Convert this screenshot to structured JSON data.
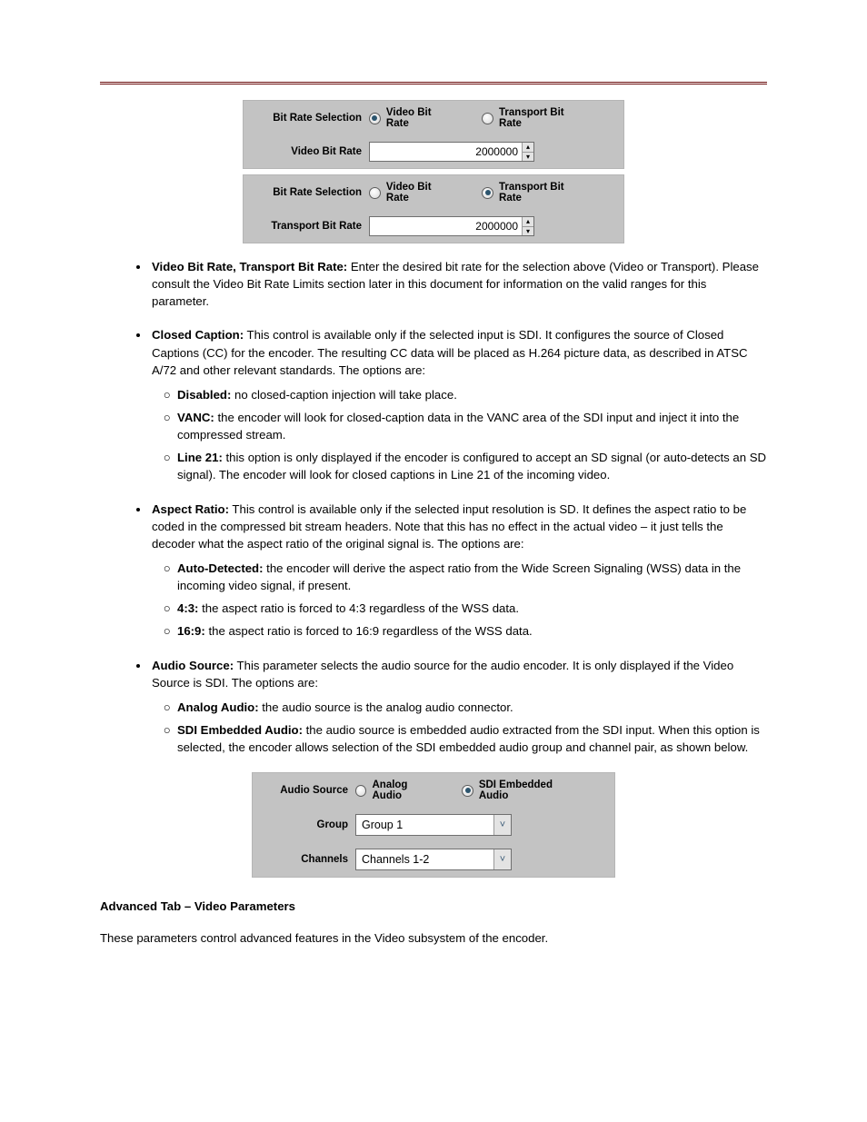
{
  "hr_color": "#6b0d0d",
  "panel1": {
    "label_sel": "Bit Rate Selection",
    "opt_video": "Video Bit Rate",
    "opt_transport": "Transport Bit Rate",
    "label_rate": "Video Bit Rate",
    "value": "2000000",
    "selected": "video"
  },
  "panel2": {
    "label_sel": "Bit Rate Selection",
    "opt_video": "Video Bit Rate",
    "opt_transport": "Transport Bit Rate",
    "label_rate": "Transport Bit Rate",
    "value": "2000000",
    "selected": "transport"
  },
  "bullets": [
    {
      "lead_bold": "Video Bit Rate, Transport Bit Rate:",
      "text": " Enter the desired bit rate for the selection above (Video or Transport). Please consult the Video Bit Rate Limits section later in this document for information on the valid ranges for this parameter."
    },
    {
      "lead_bold": "Closed Caption:",
      "text": " This control is available only if the selected input is SDI. It configures the source of Closed Captions (CC) for the encoder. The resulting CC data will be placed as H.264 picture data, as described in ATSC A/72 and other relevant standards. The options are:",
      "sub": [
        {
          "b": "Disabled:",
          "t": " no closed-caption injection will take place."
        },
        {
          "b": "VANC:",
          "t": " the encoder will look for closed-caption data in the VANC area of the SDI input and inject it into the compressed stream."
        },
        {
          "b": "Line 21:",
          "t": " this option is only displayed if the encoder is configured to accept an SD signal (or auto-detects an SD signal). The encoder will look for closed captions in Line 21 of the incoming video."
        }
      ]
    },
    {
      "lead_bold": "Aspect Ratio:",
      "text": " This control is available only if the selected input resolution is SD. It defines the aspect ratio to be coded in the compressed bit stream headers. Note that this has no effect in the actual video – it just tells the decoder what the aspect ratio of the original signal is. The options are:",
      "sub": [
        {
          "b": "Auto-Detected:",
          "t": " the encoder will derive the aspect ratio from the Wide Screen Signaling (WSS) data in the incoming video signal, if present."
        },
        {
          "b": "4:3:",
          "t": " the aspect ratio is forced to 4:3 regardless of the WSS data."
        },
        {
          "b": "16:9:",
          "t": " the aspect ratio is forced to 16:9 regardless of the WSS data."
        }
      ]
    },
    {
      "lead_bold": "Audio Source:",
      "text": " This parameter selects the audio source for the audio encoder. It is only displayed if the Video Source is SDI. The options are:",
      "sub": [
        {
          "b": "Analog Audio:",
          "t": " the audio source is the analog audio connector."
        },
        {
          "b": "SDI Embedded Audio:",
          "t": " the audio source is embedded audio extracted from the SDI input. When this option is selected, the encoder allows selection of the SDI embedded audio group and channel pair, as shown below."
        }
      ]
    }
  ],
  "panel3": {
    "label_src": "Audio Source",
    "opt_analog": "Analog Audio",
    "opt_sdi": "SDI Embedded Audio",
    "selected": "sdi",
    "label_group": "Group",
    "group_value": "Group 1",
    "label_channels": "Channels",
    "channels_value": "Channels 1-2"
  },
  "section_title": "Advanced Tab – Video Parameters",
  "after_text": "These parameters control advanced features in the Video subsystem of the encoder."
}
